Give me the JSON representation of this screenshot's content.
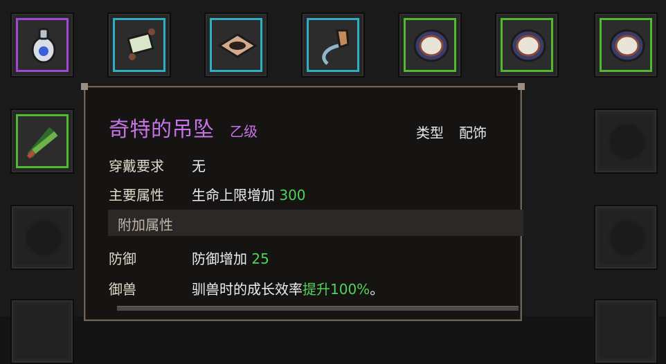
{
  "inventory": {
    "row1": [
      {
        "icon": "pendant-icon",
        "rarity": "purple"
      },
      {
        "icon": "scroll-icon",
        "rarity": "cyan"
      },
      {
        "icon": "leather-patch-icon",
        "rarity": "cyan"
      },
      {
        "icon": "hook-icon",
        "rarity": "cyan"
      },
      {
        "icon": "round-shield-icon",
        "rarity": "green"
      },
      {
        "icon": "round-shield-icon",
        "rarity": "green"
      },
      {
        "icon": "round-shield-icon",
        "rarity": "green"
      }
    ],
    "row2": [
      {
        "icon": "herb-bundle-icon",
        "rarity": "green"
      }
    ],
    "colors": {
      "purple": "#a347d6",
      "cyan": "#2bb0c4",
      "green": "#52b82e"
    }
  },
  "tooltip": {
    "name": "奇特的吊坠",
    "grade": "乙级",
    "type_label": "类型",
    "type_value": "配饰",
    "requirement_label": "穿戴要求",
    "requirement_value": "无",
    "main_attr_label": "主要属性",
    "main_attr_text": "生命上限增加 ",
    "main_attr_num": "300",
    "extra_attr_header": "附加属性",
    "defense_label": "防御",
    "defense_text": "防御增加 ",
    "defense_num": "25",
    "taming_label": "御兽",
    "taming_text": "驯兽时的成长效率",
    "taming_highlight": "提升100%",
    "taming_suffix": "。",
    "name_color": "#c873e8",
    "value_color": "#4fd35a"
  }
}
